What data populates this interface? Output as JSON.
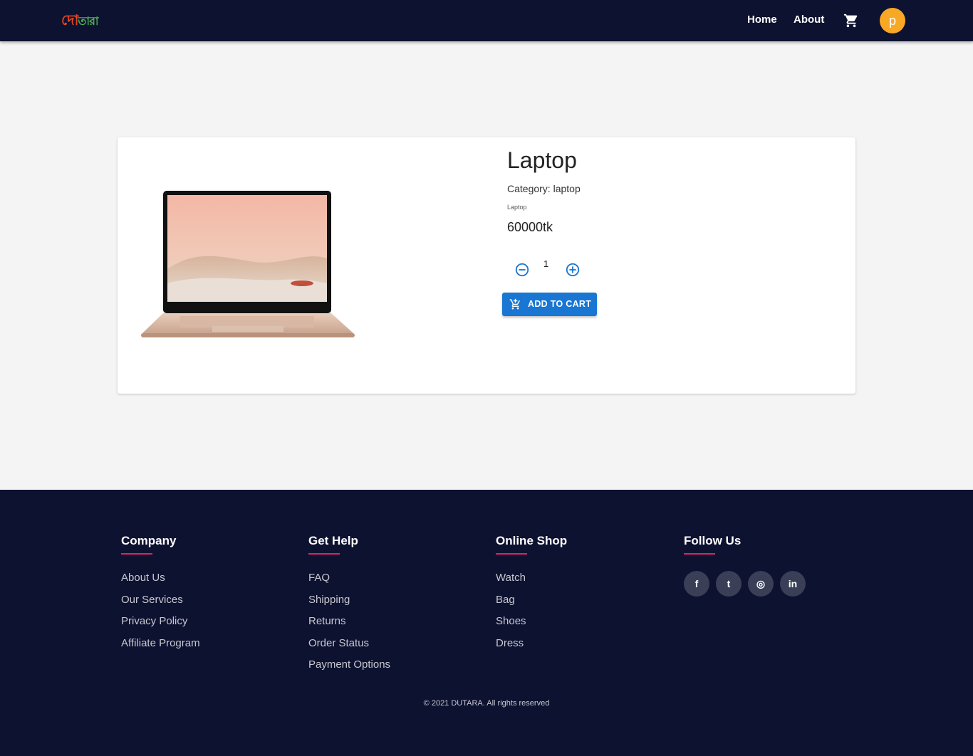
{
  "navbar": {
    "logo_part1": "দো",
    "logo_part2": "তারা",
    "home_label": "Home",
    "about_label": "About",
    "cart_icon": "cart-icon",
    "avatar_letter": "p"
  },
  "product": {
    "title": "Laptop",
    "category": "Category: laptop",
    "description": "Laptop",
    "price": "60000tk",
    "quantity": "1",
    "add_to_cart_label": "ADD TO CART"
  },
  "footer": {
    "columns": [
      {
        "title": "Company",
        "links": [
          "About Us",
          "Our Services",
          "Privacy Policy",
          "Affiliate Program"
        ]
      },
      {
        "title": "Get Help",
        "links": [
          "FAQ",
          "Shipping",
          "Returns",
          "Order Status",
          "Payment Options"
        ]
      },
      {
        "title": "Online Shop",
        "links": [
          "Watch",
          "Bag",
          "Shoes",
          "Dress"
        ]
      },
      {
        "title": "Follow Us",
        "links": []
      }
    ],
    "social": [
      {
        "icon": "facebook-icon",
        "glyph": "f"
      },
      {
        "icon": "twitter-icon",
        "glyph": "t"
      },
      {
        "icon": "instagram-icon",
        "glyph": "◎"
      },
      {
        "icon": "linkedin-icon",
        "glyph": "in"
      }
    ],
    "copyright": "© 2021 DUTARA. All rights reserved"
  },
  "colors": {
    "navbar_bg": "#0d1230",
    "accent_blue": "#1976d2",
    "avatar_bg": "#f9a825",
    "footer_underline": "#e91e63"
  }
}
